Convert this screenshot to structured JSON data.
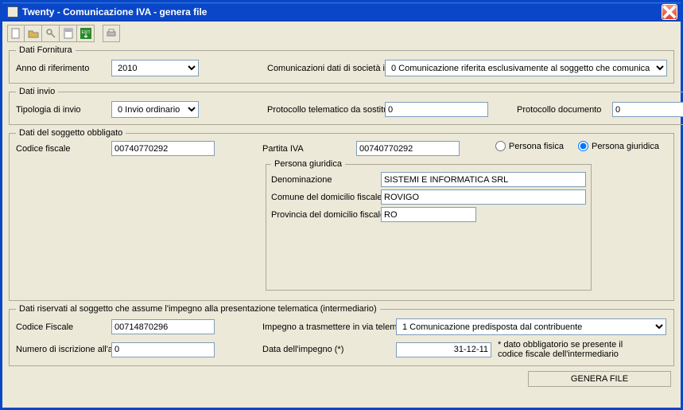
{
  "window": {
    "title": "Twenty - Comunicazione IVA - genera file"
  },
  "toolbar": {
    "icons": [
      "new-icon",
      "open-icon",
      "key-icon",
      "calc-icon",
      "exit-icon",
      "print-icon"
    ]
  },
  "fornitura": {
    "legend": "Dati Fornitura",
    "anno_label": "Anno di riferimento",
    "anno_value": "2010",
    "comdati_label": "Comunicazioni dati di società incorporata",
    "comdati_value": "0 Comunicazione riferita esclusivamente al soggetto che comunica"
  },
  "invio": {
    "legend": "Dati invio",
    "tipologia_label": "Tipologia di invio",
    "tipologia_value": "0 Invio ordinario",
    "protocollo_tel_label": "Protocollo telematico da sostituire o annullare",
    "protocollo_tel_value": "0",
    "protocollo_doc_label": "Protocollo documento",
    "protocollo_doc_value": "0"
  },
  "soggetto": {
    "legend": "Dati del soggetto obbligato",
    "codfisc_label": "Codice fiscale",
    "codfisc_value": "00740770292",
    "piva_label": "Partita IVA",
    "piva_value": "00740770292",
    "persona_fisica_label": "Persona fisica",
    "persona_giuridica_label": "Persona giuridica",
    "persona_selected": "giuridica",
    "pg": {
      "legend": "Persona giuridica",
      "denom_label": "Denominazione",
      "denom_value": "SISTEMI E INFORMATICA SRL",
      "comune_label": "Comune del domicilio fiscale",
      "comune_value": "ROVIGO",
      "provincia_label": "Provincia del domicilio fiscale",
      "provincia_value": "RO"
    }
  },
  "intermediario": {
    "legend": "Dati riservati al soggetto che assume l'impegno alla presentazione telematica (intermediario)",
    "codfisc_label": "Codice Fiscale",
    "codfisc_value": "00714870296",
    "impegno_label": "Impegno a trasmettere in via telematica la comunicazione",
    "impegno_value": "1 Comunicazione predisposta dal contribuente",
    "numiscr_label": "Numero di iscrizione all'albo del C.A.F.",
    "numiscr_value": "0",
    "dataimp_label": "Data dell'impegno (*)",
    "dataimp_value": "31-12-11",
    "note": "* dato obbligatorio se presente il codice fiscale dell'intermediario"
  },
  "buttons": {
    "genera": "GENERA FILE"
  }
}
